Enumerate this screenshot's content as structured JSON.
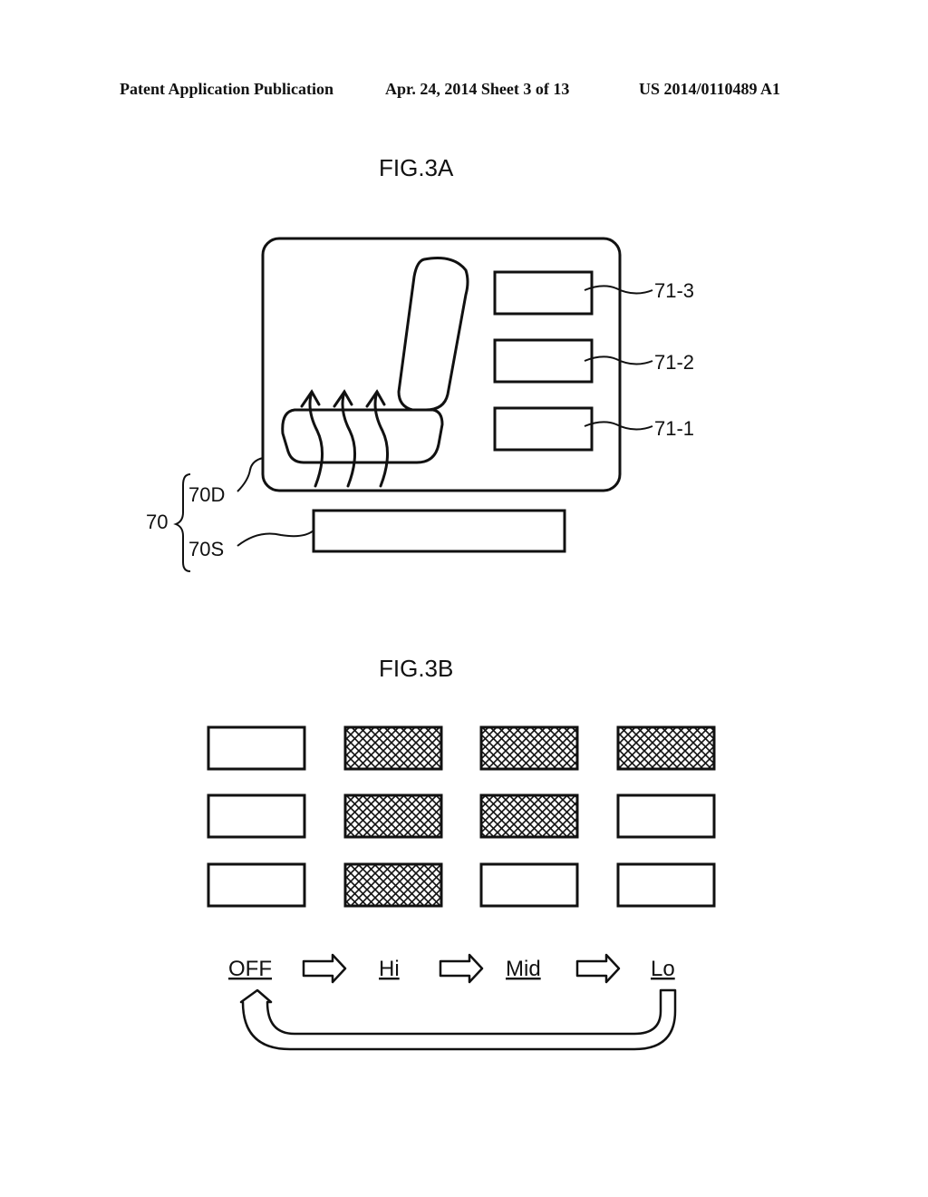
{
  "header": {
    "left": "Patent Application Publication",
    "middle": "Apr. 24, 2014  Sheet 3 of 13",
    "right": "US 2014/0110489 A1"
  },
  "fig3a": {
    "title": "FIG.3A",
    "labels": {
      "switch_3": "71-3",
      "switch_2": "71-2",
      "switch_1": "71-1",
      "display": "70D",
      "switch_unit": "70S",
      "device": "70"
    },
    "icons": [
      "seat-icon",
      "heat-wave-icon"
    ]
  },
  "fig3b": {
    "title": "FIG.3B",
    "states": [
      {
        "label": "OFF",
        "indicators_lit": [
          false,
          false,
          false
        ]
      },
      {
        "label": "Hi",
        "indicators_lit": [
          true,
          true,
          true
        ]
      },
      {
        "label": "Mid",
        "indicators_lit": [
          false,
          true,
          true
        ]
      },
      {
        "label": "Lo",
        "indicators_lit": [
          false,
          false,
          true
        ]
      }
    ],
    "transition_arrow": "right-arrow-icon",
    "return_arrow": "return-arrow-icon"
  }
}
